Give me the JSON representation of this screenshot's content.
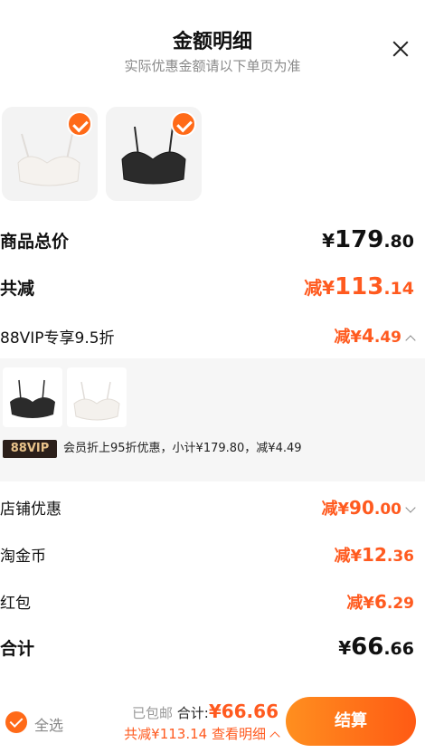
{
  "header": {
    "title": "金额明细",
    "subtitle": "实际优惠金额请以下单页为准"
  },
  "products": [
    {
      "name": "white-bra",
      "selected": true
    },
    {
      "name": "black-bra",
      "selected": true
    }
  ],
  "summary": {
    "total_label": "商品总价",
    "total_yen": "¥",
    "total_int": "179",
    "total_dec": ".80",
    "discount_label": "共减",
    "discount_prefix": "减¥",
    "discount_int": "113",
    "discount_dec": ".14",
    "vip_label": "88VIP专享9.5折",
    "vip_prefix": "减¥",
    "vip_int": "4",
    "vip_dec": ".49"
  },
  "vip_detail": {
    "badge": "88VIP",
    "text": "会员折上95折优惠，小计¥179.80，减¥4.49"
  },
  "lines": {
    "shop_label": "店铺优惠",
    "shop_prefix": "减¥",
    "shop_int": "90",
    "shop_dec": ".00",
    "coin_label": "淘金币",
    "coin_prefix": "减¥",
    "coin_int": "12",
    "coin_dec": ".36",
    "redpack_label": "红包",
    "redpack_prefix": "减¥",
    "redpack_int": "6",
    "redpack_dec": ".29",
    "sum_label": "合计",
    "sum_yen": "¥",
    "sum_int": "66",
    "sum_dec": ".66"
  },
  "bottom": {
    "select_all": "全选",
    "free_shipping": "已包邮",
    "total_label": "合计:",
    "total_value": "¥66.66",
    "saved_text": "共减¥113.14",
    "details_link": "查看明细",
    "settle_button": "结算"
  },
  "colors": {
    "accent": "#ff5a1f",
    "vip_badge_bg": "#2b1f1a",
    "vip_badge_text": "#e8c28a"
  }
}
